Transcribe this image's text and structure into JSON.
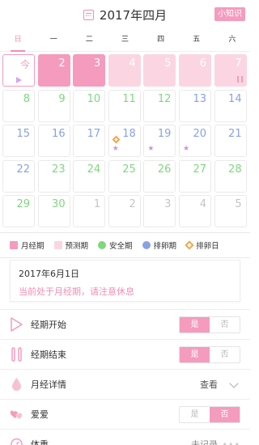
{
  "header": {
    "title": "2017年四月",
    "knowledge_label": "小知识"
  },
  "weekdays": [
    "日",
    "一",
    "二",
    "三",
    "四",
    "五",
    "六"
  ],
  "calendar": {
    "rows": [
      [
        {
          "label": "今",
          "type": "today",
          "tri": true
        },
        {
          "label": "2",
          "type": "period"
        },
        {
          "label": "3",
          "type": "period"
        },
        {
          "label": "4",
          "type": "predict"
        },
        {
          "label": "5",
          "type": "predict"
        },
        {
          "label": "6",
          "type": "predict"
        },
        {
          "label": "7",
          "type": "predict",
          "pause": true
        }
      ],
      [
        {
          "label": "8",
          "type": "safe"
        },
        {
          "label": "9",
          "type": "safe"
        },
        {
          "label": "10",
          "type": "safe"
        },
        {
          "label": "11",
          "type": "safe"
        },
        {
          "label": "12",
          "type": "safe"
        },
        {
          "label": "13",
          "type": "ovu"
        },
        {
          "label": "14",
          "type": "ovu"
        }
      ],
      [
        {
          "label": "15",
          "type": "ovu"
        },
        {
          "label": "16",
          "type": "ovu"
        },
        {
          "label": "17",
          "type": "ovu"
        },
        {
          "label": "18",
          "type": "ovu",
          "star": true,
          "diamond": true
        },
        {
          "label": "19",
          "type": "ovu",
          "star": true
        },
        {
          "label": "20",
          "type": "ovu",
          "star": true
        },
        {
          "label": "21",
          "type": "ovu"
        }
      ],
      [
        {
          "label": "22",
          "type": "ovu"
        },
        {
          "label": "23",
          "type": "safe"
        },
        {
          "label": "24",
          "type": "safe"
        },
        {
          "label": "25",
          "type": "safe"
        },
        {
          "label": "26",
          "type": "safe"
        },
        {
          "label": "27",
          "type": "safe"
        },
        {
          "label": "28",
          "type": "safe"
        }
      ],
      [
        {
          "label": "29",
          "type": "safe"
        },
        {
          "label": "30",
          "type": "safe"
        },
        {
          "label": "1",
          "type": "other"
        },
        {
          "label": "2",
          "type": "other"
        },
        {
          "label": "3",
          "type": "other"
        },
        {
          "label": "4",
          "type": "other"
        },
        {
          "label": "5",
          "type": "other"
        }
      ]
    ]
  },
  "legend": [
    {
      "label": "月经期",
      "shape": "square",
      "color": "#f59bbd"
    },
    {
      "label": "预测期",
      "shape": "square",
      "color": "#fbd6e2"
    },
    {
      "label": "安全期",
      "shape": "dot",
      "color": "#7ed87e"
    },
    {
      "label": "排卵期",
      "shape": "dot",
      "color": "#8aa1e6"
    },
    {
      "label": "排卵日",
      "shape": "diamond",
      "color": "#f2a64d"
    }
  ],
  "info": {
    "date": "2017年6月1日",
    "message": "当前处于月经期，请注意休息"
  },
  "rows": {
    "period_start": {
      "label": "经期开始",
      "yes": "是",
      "no": "否"
    },
    "period_end": {
      "label": "经期结束",
      "yes": "是",
      "no": "否"
    },
    "period_detail": {
      "label": "月经详情",
      "view": "查看"
    },
    "love": {
      "label": "爱爱",
      "yes": "是",
      "no": "否"
    },
    "weight": {
      "label": "体重",
      "record": "未记录",
      "dots": "•••"
    }
  },
  "colors": {
    "accent": "#f59bbd",
    "predict": "#fbd6e2",
    "safe": "#7ed87e",
    "ovulation": "#8aa1e6",
    "ovulation_day": "#f2a64d"
  }
}
